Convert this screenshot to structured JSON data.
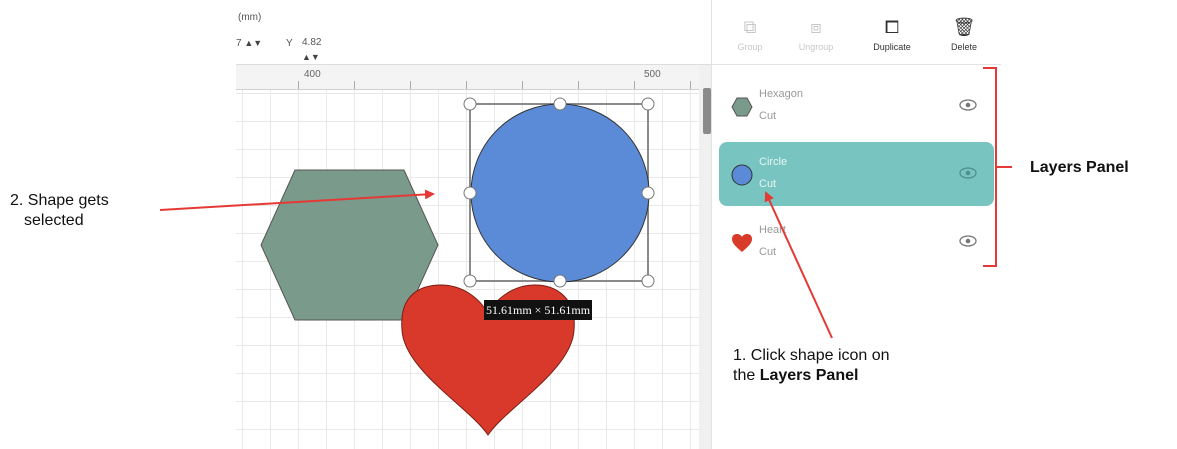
{
  "toolbar": {
    "unit": "(mm)",
    "w_value": "7",
    "y_label": "Y",
    "y_value": "4.82",
    "stepper": "▲▼"
  },
  "ruler": {
    "labels": [
      "400",
      "500"
    ]
  },
  "panel_toolbar": {
    "group_label": "Group",
    "ungroup_label": "Ungroup",
    "duplicate_label": "Duplicate",
    "delete_label": "Delete"
  },
  "layers": [
    {
      "name": "Hexagon",
      "operation": "Cut",
      "icon": "hexagon-icon",
      "color": "#7a9a8c",
      "selected": false
    },
    {
      "name": "Circle",
      "operation": "Cut",
      "icon": "circle-icon",
      "color": "#5b8ad6",
      "selected": true
    },
    {
      "name": "Heart",
      "operation": "Cut",
      "icon": "heart-icon",
      "color": "#d93b2b",
      "selected": false
    }
  ],
  "canvas": {
    "dimension_label": "51.61mm × 51.61mm",
    "shape_colors": {
      "hexagon": "#7a9a8c",
      "circle": "#5b8ad6",
      "heart": "#d9392a"
    }
  },
  "annotations": {
    "shape_selected_line1": "2. Shape gets",
    "shape_selected_line2": "selected",
    "layers_panel_label": "Layers Panel",
    "click_icon_line1": "1. Click shape icon on",
    "click_icon_line2_prefix": "the",
    "click_icon_line2_bold": "Layers Panel",
    "arrow_color": "#e53935"
  }
}
